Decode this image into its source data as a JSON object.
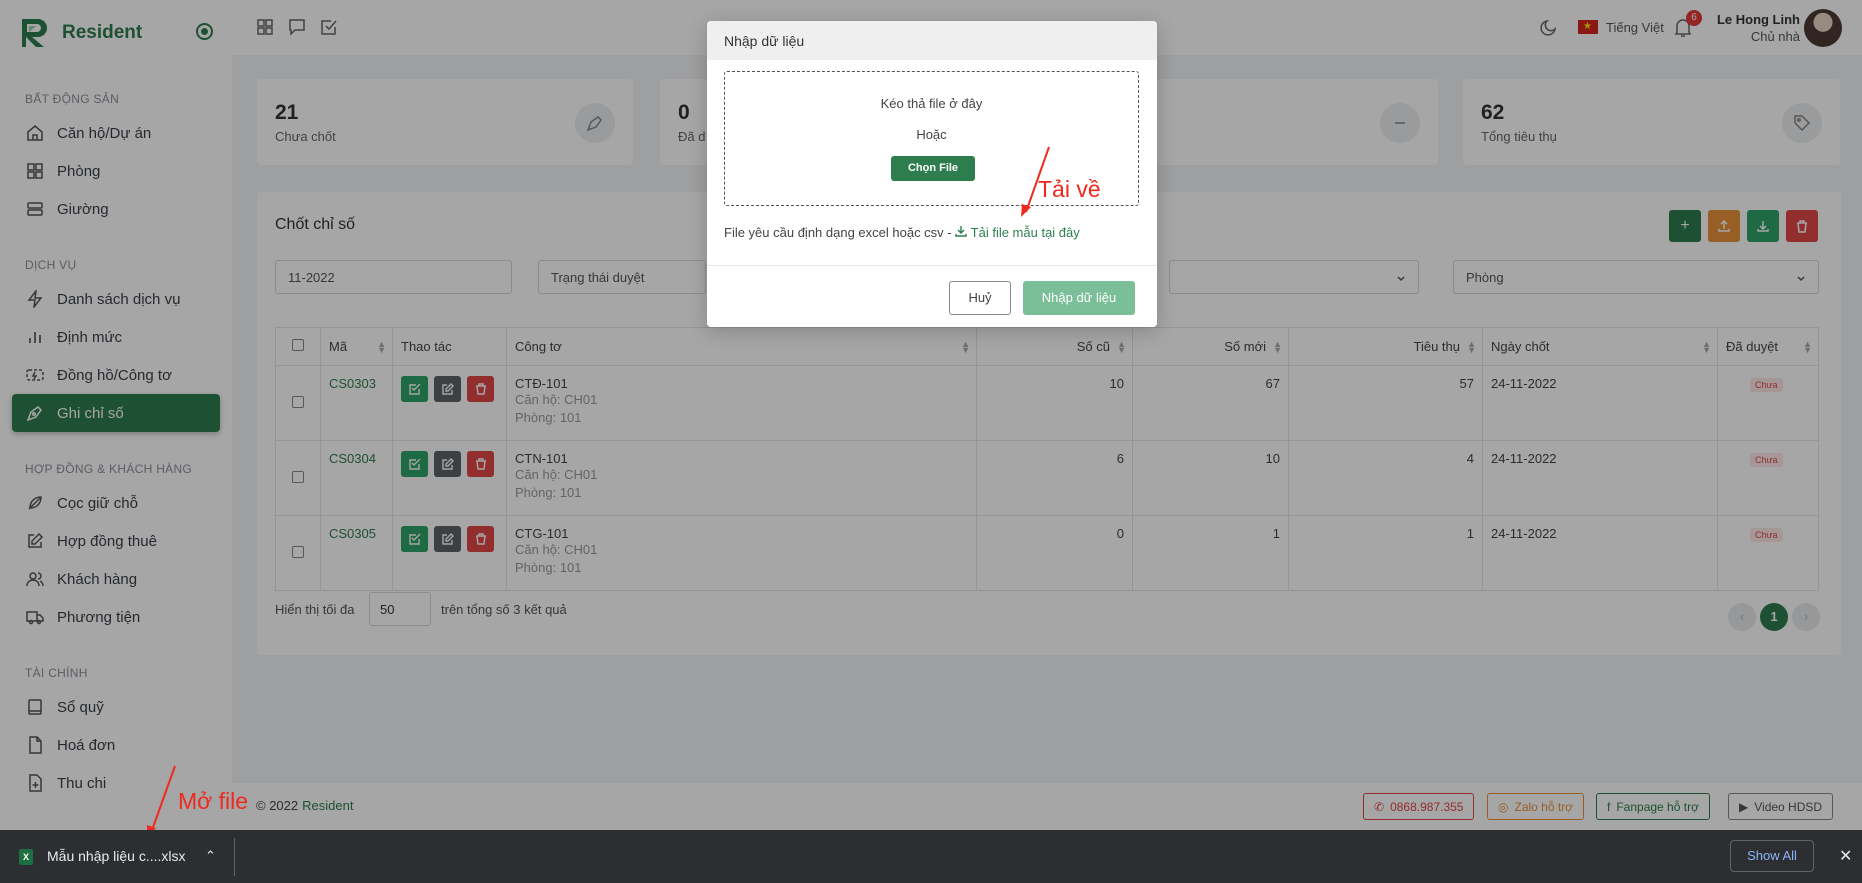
{
  "app": {
    "brand": "Resident"
  },
  "sidebar": {
    "sections": [
      {
        "title": "BẤT ĐỘNG SẢN",
        "items": [
          "Căn hộ/Dự án",
          "Phòng",
          "Giường"
        ]
      },
      {
        "title": "DỊCH VỤ",
        "items": [
          "Danh sách dịch vụ",
          "Định mức",
          "Đồng hồ/Công tơ",
          "Ghi chỉ số"
        ]
      },
      {
        "title": "HỢP ĐỒNG & KHÁCH HÀNG",
        "items": [
          "Cọc giữ chỗ",
          "Hợp đồng thuê",
          "Khách hàng",
          "Phương tiện"
        ]
      },
      {
        "title": "TÀI CHÍNH",
        "items": [
          "Sổ quỹ",
          "Hoá đơn",
          "Thu chi"
        ]
      }
    ],
    "active": "Ghi chỉ số"
  },
  "topbar": {
    "language": "Tiếng Việt",
    "notification_count": "6",
    "user_name": "Le Hong Linh",
    "user_role": "Chủ nhà"
  },
  "stats": [
    {
      "value": "21",
      "label": "Chưa chốt"
    },
    {
      "value": "0",
      "label": "Đã d"
    },
    {
      "value": "62",
      "label": "Tổng tiêu thụ"
    }
  ],
  "panel": {
    "title": "Chốt chỉ số",
    "filters": {
      "month": "11-2022",
      "status_placeholder": "Trạng thái duyệt",
      "room_placeholder": "Phòng"
    },
    "columns": [
      "Mã",
      "Thao tác",
      "Công tơ",
      "Số cũ",
      "Số mới",
      "Tiêu thụ",
      "Ngày chốt",
      "Đã duyệt"
    ],
    "rows": [
      {
        "code": "CS0303",
        "meter": "CTĐ-101",
        "apartment": "Căn hộ: CH01",
        "room": "Phòng: 101",
        "old": "10",
        "new": "67",
        "usage": "57",
        "date": "24-11-2022",
        "status": "Chưa"
      },
      {
        "code": "CS0304",
        "meter": "CTN-101",
        "apartment": "Căn hộ: CH01",
        "room": "Phòng: 101",
        "old": "6",
        "new": "10",
        "usage": "4",
        "date": "24-11-2022",
        "status": "Chưa"
      },
      {
        "code": "CS0305",
        "meter": "CTG-101",
        "apartment": "Căn hộ: CH01",
        "room": "Phòng: 101",
        "old": "0",
        "new": "1",
        "usage": "1",
        "date": "24-11-2022",
        "status": "Chưa"
      }
    ],
    "pager": {
      "show_label": "Hiển thị tối đa",
      "page_size": "50",
      "total_label": "trên tổng số 3 kết quả",
      "current_page": "1"
    }
  },
  "footer": {
    "copyright": "© 2022",
    "brand": "Resident",
    "phone": "0868.987.355",
    "zalo": "Zalo hỗ trợ",
    "fanpage": "Fanpage hỗ trợ",
    "video": "Video HDSD"
  },
  "modal": {
    "title": "Nhập dữ liệu",
    "drop_text": "Kéo thả file ở đây",
    "or_text": "Hoặc",
    "choose_button": "Chọn File",
    "requirement": "File yêu cầu định dạng excel hoặc csv -",
    "template_link": "Tải file mẫu tại đây",
    "cancel_button": "Huỷ",
    "import_button": "Nhập dữ liệu"
  },
  "annotations": {
    "download": "Tải về",
    "open": "Mở file"
  },
  "download_bar": {
    "file_name": "Mẫu nhập liệu c....xlsx",
    "show_all": "Show All"
  },
  "colors": {
    "brand_green": "#2e7d4f",
    "danger": "#e04848",
    "warning": "#e8933a"
  }
}
